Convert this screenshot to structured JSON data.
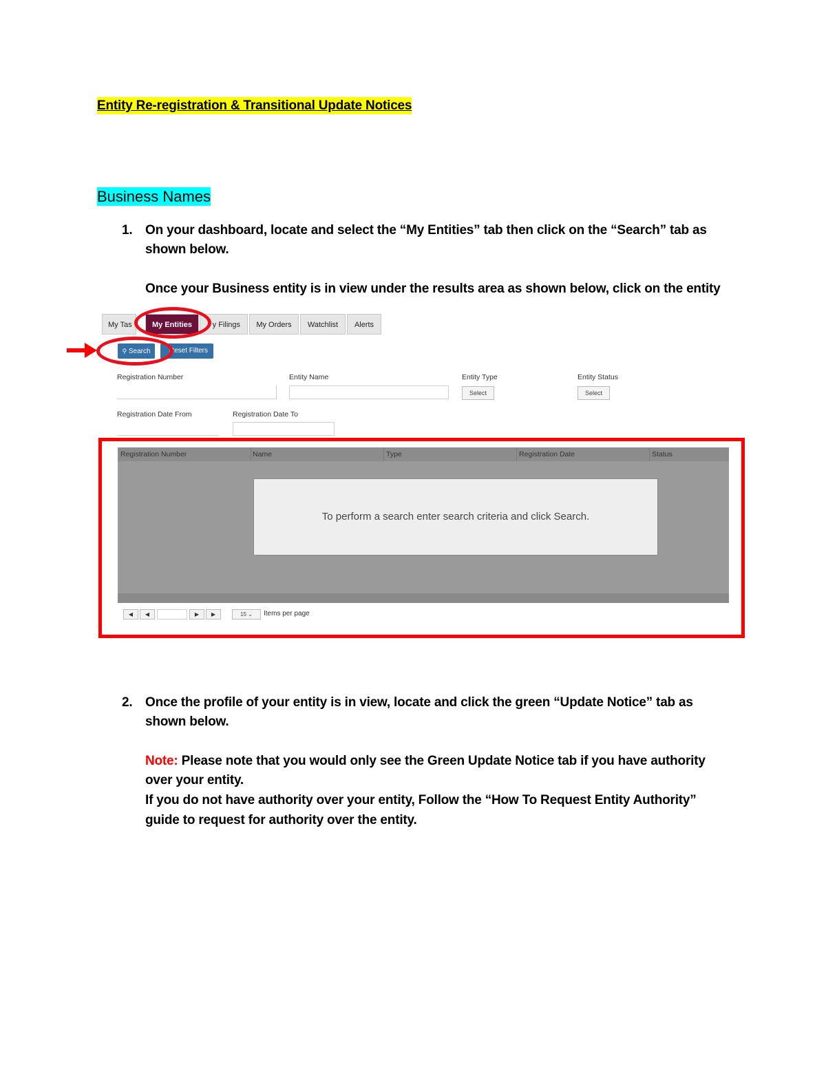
{
  "doc": {
    "title": "Entity Re-registration & Transitional Update Notices",
    "section": "Business Names",
    "step1": {
      "number": "1.",
      "line1": "On your dashboard, locate and select the “My Entities” tab then click on the “Search” tab as",
      "line2": "shown below.",
      "line3": "Once your Business entity is in view under the results area as shown below, click on the entity"
    },
    "step2": {
      "number": "2.",
      "line1": "Once the profile of your entity is in view, locate and click the green “Update Notice” tab as",
      "line2": "shown below.",
      "note_label": "Note:",
      "note_line1": " Please note that you would only see the Green Update Notice tab if you have authority",
      "note_line2": "over your entity.",
      "line3": "If you do not have authority over your entity, Follow the “How To Request Entity Authority”",
      "line4": "guide to request for authority over the entity."
    }
  },
  "screenshot": {
    "tabs": [
      "My Tasks",
      "My Entities",
      "My Filings",
      "My Orders",
      "Watchlist",
      "Alerts"
    ],
    "tabs_visible": [
      "My Tas",
      "My Entities",
      "y Filings",
      "My Orders",
      "Watchlist",
      "Alerts"
    ],
    "active_tab": "My Entities",
    "buttons": {
      "search": "Search",
      "reset": "Reset Filters"
    },
    "fields": {
      "registration_number": "Registration Number",
      "entity_name": "Entity Name",
      "entity_type": "Entity Type",
      "entity_status": "Entity Status",
      "reg_date_from": "Registration Date From",
      "reg_date_to": "Registration Date To",
      "select_placeholder": "Select",
      "select_placeholder2": "Select"
    },
    "grid": {
      "columns": [
        "Registration Number",
        "Name",
        "Type",
        "Registration Date",
        "Status"
      ],
      "empty_message": "To perform a search enter search criteria and click Search."
    },
    "pager": {
      "page_size": "15",
      "items_label": "Items per page"
    }
  },
  "colors": {
    "highlight_yellow": "#ffff00",
    "highlight_cyan": "#00ffff",
    "annotation_red": "#ff0000",
    "active_tab": "#6b1038",
    "button_blue": "#3570a6"
  }
}
